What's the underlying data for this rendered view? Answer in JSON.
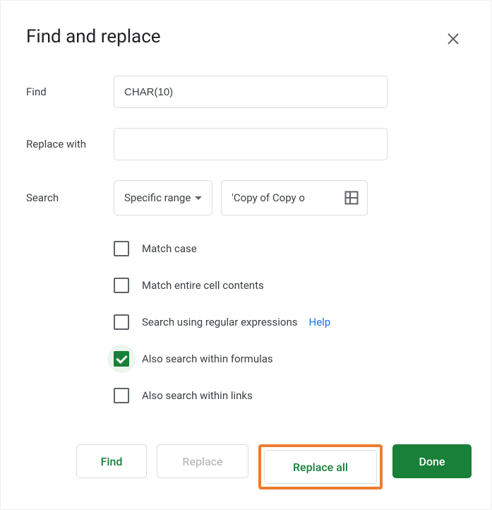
{
  "dialog": {
    "title": "Find and replace"
  },
  "fields": {
    "find_label": "Find",
    "find_value": "CHAR(10)",
    "replace_label": "Replace with",
    "replace_value": "",
    "search_label": "Search",
    "search_scope": "Specific range",
    "range_value": "'Copy of Copy o"
  },
  "options": {
    "match_case": {
      "label": "Match case",
      "checked": false
    },
    "match_entire": {
      "label": "Match entire cell contents",
      "checked": false
    },
    "regex": {
      "label": "Search using regular expressions",
      "checked": false,
      "help": "Help"
    },
    "formulas": {
      "label": "Also search within formulas",
      "checked": true
    },
    "links": {
      "label": "Also search within links",
      "checked": false
    }
  },
  "buttons": {
    "find": "Find",
    "replace": "Replace",
    "replace_all": "Replace all",
    "done": "Done"
  }
}
